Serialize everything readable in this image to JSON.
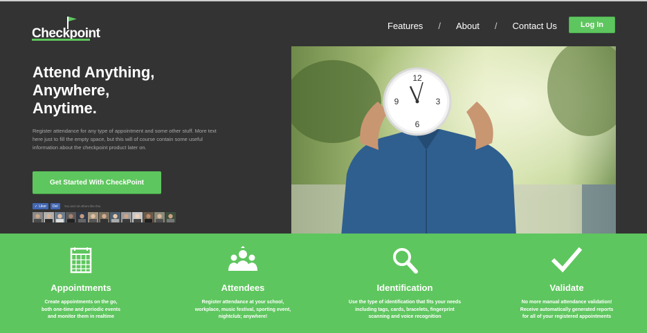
{
  "header": {
    "logo_text": "Checkpoint",
    "nav": [
      "Features",
      "About",
      "Contact Us"
    ],
    "nav_separator": "/",
    "login_label": "Log In"
  },
  "hero": {
    "headline": [
      "Attend Anything,",
      "Anywhere,",
      "Anytime."
    ],
    "description": "Register attendance for any type of appointment and some other stuff. More text here just to fill the empty space, but this will of course contain some useful information about the checkpoint product later on.",
    "cta_label": "Get Started With CheckPoint",
    "social": {
      "like_label": "Liker",
      "share_label": "Del",
      "like_text": "You and 18 others like this."
    }
  },
  "features": [
    {
      "icon": "calendar-icon",
      "title": "Appointments",
      "desc_lines": [
        "Create appointments on the go,",
        "both one-time and periodic events",
        "and monitor them in realtime"
      ]
    },
    {
      "icon": "people-icon",
      "title": "Attendees",
      "desc_lines": [
        "Register attendance at your school,",
        "workplace, music festival, sporting event,",
        "nightclub; anywhere!"
      ]
    },
    {
      "icon": "search-icon",
      "title": "Identification",
      "desc_lines": [
        "Use the type of identification that fits your needs",
        "including tags, cards, bracelets, fingerprint",
        "scanning and voice recognition"
      ]
    },
    {
      "icon": "checkmark-icon",
      "title": "Validate",
      "desc_lines": [
        "No more manual attendance validation!",
        "Receive automatically generated reports",
        "for all of your registered appointments"
      ]
    }
  ],
  "colors": {
    "accent": "#5ec65e",
    "background": "#333333",
    "facebook": "#4267b2"
  }
}
